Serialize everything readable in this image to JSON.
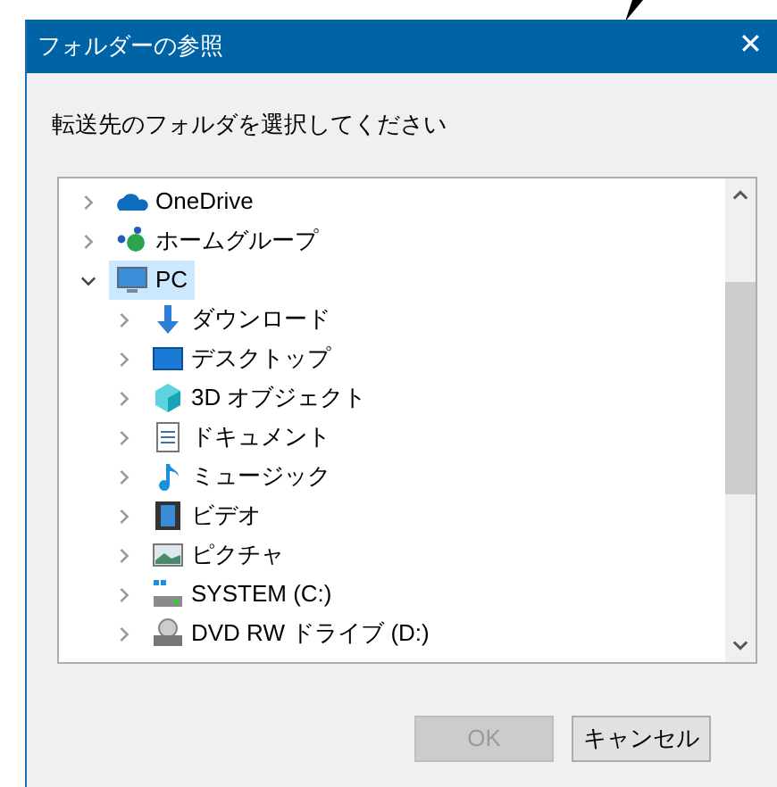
{
  "window": {
    "title": "フォルダーの参照",
    "close": "✕"
  },
  "prompt": "転送先のフォルダを選択してください",
  "tree": [
    {
      "label": "OneDrive",
      "kind": "cloud",
      "expanded": false,
      "selected": false
    },
    {
      "label": "ホームグループ",
      "kind": "homegroup",
      "expanded": false,
      "selected": false
    },
    {
      "label": "PC",
      "kind": "pc",
      "expanded": true,
      "selected": true,
      "children": [
        {
          "label": "ダウンロード",
          "kind": "download",
          "expanded": false,
          "selected": false
        },
        {
          "label": "デスクトップ",
          "kind": "desktop",
          "expanded": false,
          "selected": false
        },
        {
          "label": "3D オブジェクト",
          "kind": "cube",
          "expanded": false,
          "selected": false
        },
        {
          "label": "ドキュメント",
          "kind": "document",
          "expanded": false,
          "selected": false
        },
        {
          "label": "ミュージック",
          "kind": "music",
          "expanded": false,
          "selected": false
        },
        {
          "label": "ビデオ",
          "kind": "video",
          "expanded": false,
          "selected": false
        },
        {
          "label": "ピクチャ",
          "kind": "picture",
          "expanded": false,
          "selected": false
        },
        {
          "label": "SYSTEM (C:)",
          "kind": "drive",
          "expanded": false,
          "selected": false
        },
        {
          "label": "DVD RW ドライブ (D:)",
          "kind": "dvd",
          "expanded": false,
          "selected": false
        }
      ]
    }
  ],
  "buttons": [
    {
      "label": "OK",
      "disabled": true
    },
    {
      "label": "キャンセル",
      "disabled": false
    }
  ]
}
